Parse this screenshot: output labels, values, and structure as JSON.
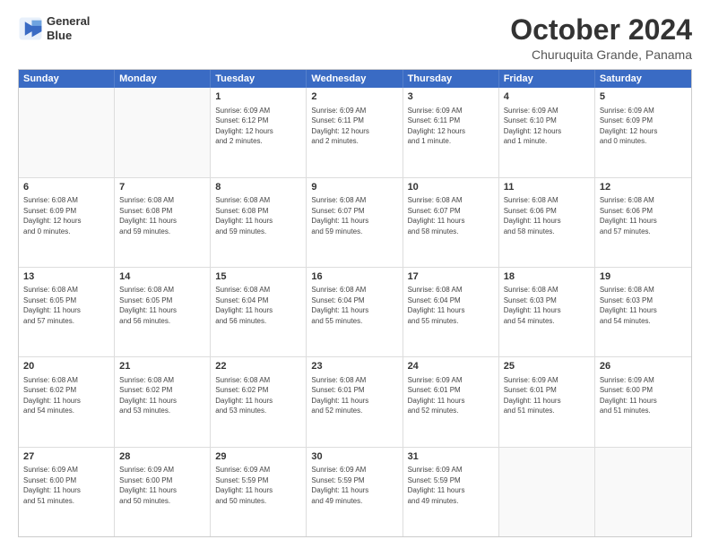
{
  "header": {
    "logo_line1": "General",
    "logo_line2": "Blue",
    "main_title": "October 2024",
    "subtitle": "Churuquita Grande, Panama"
  },
  "calendar": {
    "days_of_week": [
      "Sunday",
      "Monday",
      "Tuesday",
      "Wednesday",
      "Thursday",
      "Friday",
      "Saturday"
    ],
    "weeks": [
      [
        {
          "day": "",
          "empty": true
        },
        {
          "day": "",
          "empty": true
        },
        {
          "day": "1",
          "info": "Sunrise: 6:09 AM\nSunset: 6:12 PM\nDaylight: 12 hours\nand 2 minutes."
        },
        {
          "day": "2",
          "info": "Sunrise: 6:09 AM\nSunset: 6:11 PM\nDaylight: 12 hours\nand 2 minutes."
        },
        {
          "day": "3",
          "info": "Sunrise: 6:09 AM\nSunset: 6:11 PM\nDaylight: 12 hours\nand 1 minute."
        },
        {
          "day": "4",
          "info": "Sunrise: 6:09 AM\nSunset: 6:10 PM\nDaylight: 12 hours\nand 1 minute."
        },
        {
          "day": "5",
          "info": "Sunrise: 6:09 AM\nSunset: 6:09 PM\nDaylight: 12 hours\nand 0 minutes."
        }
      ],
      [
        {
          "day": "6",
          "info": "Sunrise: 6:08 AM\nSunset: 6:09 PM\nDaylight: 12 hours\nand 0 minutes."
        },
        {
          "day": "7",
          "info": "Sunrise: 6:08 AM\nSunset: 6:08 PM\nDaylight: 11 hours\nand 59 minutes."
        },
        {
          "day": "8",
          "info": "Sunrise: 6:08 AM\nSunset: 6:08 PM\nDaylight: 11 hours\nand 59 minutes."
        },
        {
          "day": "9",
          "info": "Sunrise: 6:08 AM\nSunset: 6:07 PM\nDaylight: 11 hours\nand 59 minutes."
        },
        {
          "day": "10",
          "info": "Sunrise: 6:08 AM\nSunset: 6:07 PM\nDaylight: 11 hours\nand 58 minutes."
        },
        {
          "day": "11",
          "info": "Sunrise: 6:08 AM\nSunset: 6:06 PM\nDaylight: 11 hours\nand 58 minutes."
        },
        {
          "day": "12",
          "info": "Sunrise: 6:08 AM\nSunset: 6:06 PM\nDaylight: 11 hours\nand 57 minutes."
        }
      ],
      [
        {
          "day": "13",
          "info": "Sunrise: 6:08 AM\nSunset: 6:05 PM\nDaylight: 11 hours\nand 57 minutes."
        },
        {
          "day": "14",
          "info": "Sunrise: 6:08 AM\nSunset: 6:05 PM\nDaylight: 11 hours\nand 56 minutes."
        },
        {
          "day": "15",
          "info": "Sunrise: 6:08 AM\nSunset: 6:04 PM\nDaylight: 11 hours\nand 56 minutes."
        },
        {
          "day": "16",
          "info": "Sunrise: 6:08 AM\nSunset: 6:04 PM\nDaylight: 11 hours\nand 55 minutes."
        },
        {
          "day": "17",
          "info": "Sunrise: 6:08 AM\nSunset: 6:04 PM\nDaylight: 11 hours\nand 55 minutes."
        },
        {
          "day": "18",
          "info": "Sunrise: 6:08 AM\nSunset: 6:03 PM\nDaylight: 11 hours\nand 54 minutes."
        },
        {
          "day": "19",
          "info": "Sunrise: 6:08 AM\nSunset: 6:03 PM\nDaylight: 11 hours\nand 54 minutes."
        }
      ],
      [
        {
          "day": "20",
          "info": "Sunrise: 6:08 AM\nSunset: 6:02 PM\nDaylight: 11 hours\nand 54 minutes."
        },
        {
          "day": "21",
          "info": "Sunrise: 6:08 AM\nSunset: 6:02 PM\nDaylight: 11 hours\nand 53 minutes."
        },
        {
          "day": "22",
          "info": "Sunrise: 6:08 AM\nSunset: 6:02 PM\nDaylight: 11 hours\nand 53 minutes."
        },
        {
          "day": "23",
          "info": "Sunrise: 6:08 AM\nSunset: 6:01 PM\nDaylight: 11 hours\nand 52 minutes."
        },
        {
          "day": "24",
          "info": "Sunrise: 6:09 AM\nSunset: 6:01 PM\nDaylight: 11 hours\nand 52 minutes."
        },
        {
          "day": "25",
          "info": "Sunrise: 6:09 AM\nSunset: 6:01 PM\nDaylight: 11 hours\nand 51 minutes."
        },
        {
          "day": "26",
          "info": "Sunrise: 6:09 AM\nSunset: 6:00 PM\nDaylight: 11 hours\nand 51 minutes."
        }
      ],
      [
        {
          "day": "27",
          "info": "Sunrise: 6:09 AM\nSunset: 6:00 PM\nDaylight: 11 hours\nand 51 minutes."
        },
        {
          "day": "28",
          "info": "Sunrise: 6:09 AM\nSunset: 6:00 PM\nDaylight: 11 hours\nand 50 minutes."
        },
        {
          "day": "29",
          "info": "Sunrise: 6:09 AM\nSunset: 5:59 PM\nDaylight: 11 hours\nand 50 minutes."
        },
        {
          "day": "30",
          "info": "Sunrise: 6:09 AM\nSunset: 5:59 PM\nDaylight: 11 hours\nand 49 minutes."
        },
        {
          "day": "31",
          "info": "Sunrise: 6:09 AM\nSunset: 5:59 PM\nDaylight: 11 hours\nand 49 minutes."
        },
        {
          "day": "",
          "empty": true
        },
        {
          "day": "",
          "empty": true
        }
      ]
    ]
  }
}
